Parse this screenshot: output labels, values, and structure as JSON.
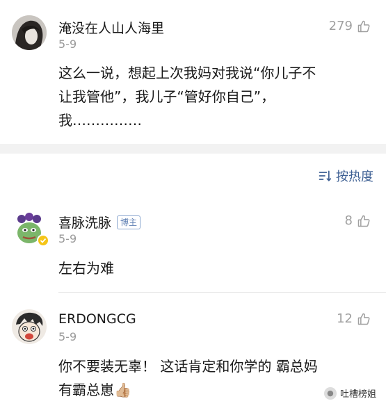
{
  "comments": [
    {
      "username": "淹没在人山人海里",
      "date": "5-9",
      "likes": "279",
      "text_lines": [
        "这么一说，想起上次我妈对我说“你儿子不",
        "让我管他”，我儿子“管好你自己”，",
        "我……………"
      ]
    },
    {
      "username": "喜脉洗脉",
      "badge": "博主",
      "date": "5-9",
      "likes": "8",
      "text_lines": [
        "左右为难"
      ]
    },
    {
      "username": "ERDONGCG",
      "date": "5-9",
      "likes": "12",
      "text_lines": [
        "你不要装无辜！ 这话肯定和你学的 霸总妈",
        "有霸总崽👍🏼"
      ]
    }
  ],
  "sort": {
    "label": "按热度",
    "icon": "sort-icon"
  },
  "watermark": {
    "label": "吐槽榜姐",
    "icon": "wechat-icon"
  },
  "colors": {
    "link": "#3d5f93",
    "muted": "#9a9a9a",
    "band": "#f2f2f2",
    "verified": "#f5c518"
  }
}
